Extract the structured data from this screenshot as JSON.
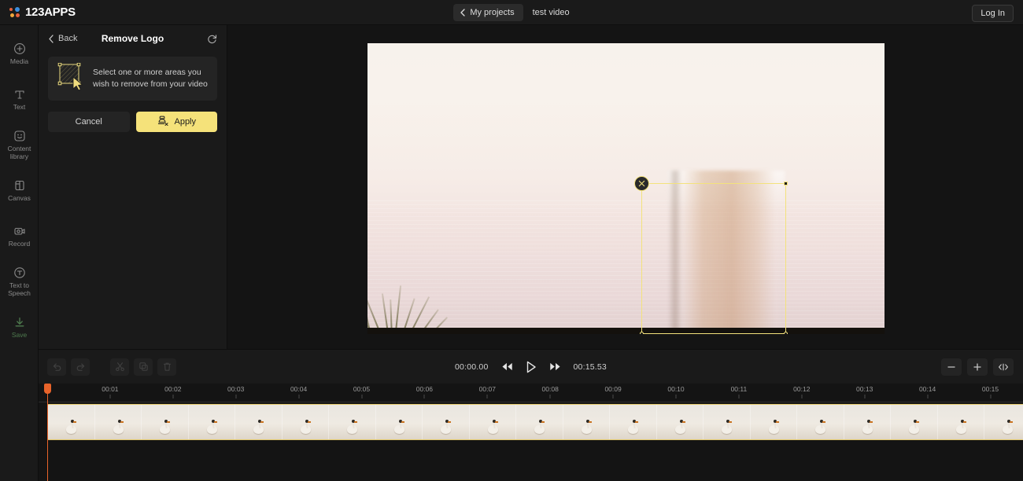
{
  "topbar": {
    "logo_text": "123APPS",
    "projects_button": "My projects",
    "project_name": "test video",
    "login_button": "Log In"
  },
  "rail": {
    "items": [
      {
        "label": "Media",
        "icon": "plus-circle-icon"
      },
      {
        "label": "Text",
        "icon": "text-t-icon"
      },
      {
        "label": "Content library",
        "icon": "sticker-smiley-icon"
      },
      {
        "label": "Canvas",
        "icon": "canvas-frame-icon"
      },
      {
        "label": "Record",
        "icon": "camera-record-icon"
      },
      {
        "label": "Text to Speech",
        "icon": "speech-circle-icon"
      },
      {
        "label": "Save",
        "icon": "download-save-icon"
      }
    ]
  },
  "panel": {
    "back_label": "Back",
    "title": "Remove Logo",
    "reset_icon": "reset-arrow-icon",
    "info_text": "Select one or more areas you wish to remove from your video",
    "cancel_label": "Cancel",
    "apply_label": "Apply",
    "apply_icon": "stamp-remove-icon"
  },
  "stage": {
    "selection": {
      "close_icon": "close-x-icon",
      "handles": [
        "top-left",
        "top-right",
        "bottom-left",
        "bottom-right"
      ]
    }
  },
  "controls": {
    "tools": [
      {
        "name": "undo",
        "icon": "undo-arrow-icon",
        "disabled": true
      },
      {
        "name": "redo",
        "icon": "redo-arrow-icon",
        "disabled": true
      },
      {
        "name": "split",
        "icon": "scissors-icon",
        "disabled": true
      },
      {
        "name": "duplicate",
        "icon": "copy-icon",
        "disabled": true
      },
      {
        "name": "delete",
        "icon": "trash-icon",
        "disabled": true
      }
    ],
    "current_time": "00:00.00",
    "total_time": "00:15.53",
    "rewind_icon": "rewind-icon",
    "play_icon": "play-icon",
    "forward_icon": "fast-forward-icon",
    "zoom_out_label": "−",
    "zoom_in_label": "+",
    "fit_icon": "fit-to-width-icon"
  },
  "timeline": {
    "ticks": [
      "00:01",
      "00:02",
      "00:03",
      "00:04",
      "00:05",
      "00:06",
      "00:07",
      "00:08",
      "00:09",
      "00:10",
      "00:11",
      "00:12",
      "00:13",
      "00:14",
      "00:15"
    ],
    "playhead_time": "00:00.00",
    "clip": {
      "thumbnail_count": 21,
      "selected": true
    }
  }
}
